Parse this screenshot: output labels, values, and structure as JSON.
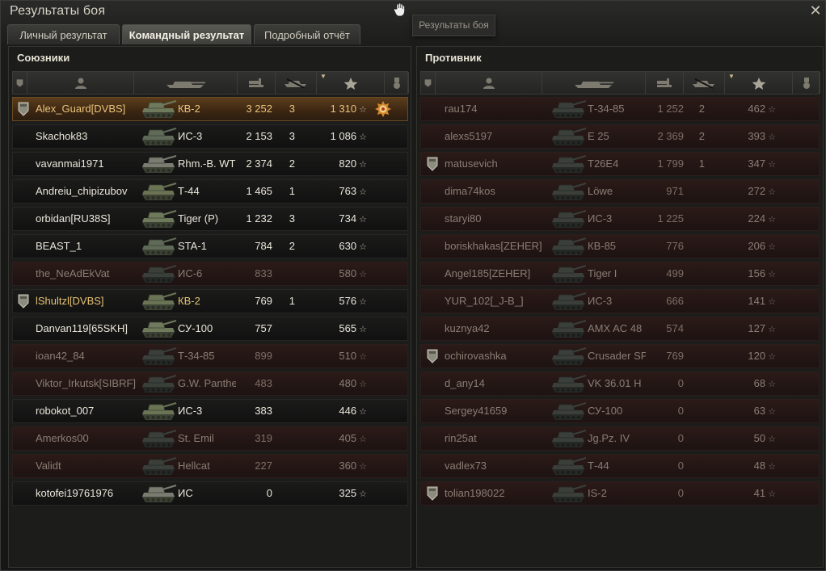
{
  "window": {
    "title": "Результаты боя",
    "tooltip": "Результаты боя"
  },
  "tabs": [
    {
      "label": "Личный результат",
      "active": false
    },
    {
      "label": "Командный результат",
      "active": true
    },
    {
      "label": "Подробный отчёт",
      "active": false
    }
  ],
  "columns": {
    "icons": [
      "clan-icon",
      "player-icon",
      "tank-icon",
      "damage-icon",
      "kills-icon",
      "xp-star-icon",
      "medal-icon"
    ],
    "sorted_by": "xp"
  },
  "allies": {
    "label": "Союзники",
    "rows": [
      {
        "name": "Alex_Guard[DVBS]",
        "vehicle": "КВ-2",
        "damage": "3 252",
        "kills": "3",
        "xp": "1 310",
        "state": "self",
        "clan": true,
        "medal": true
      },
      {
        "name": "Skachok83",
        "vehicle": "ИС-3",
        "damage": "2 153",
        "kills": "3",
        "xp": "1 086",
        "state": "alive"
      },
      {
        "name": "vavanmai1971",
        "vehicle": "Rhm.-B. WT",
        "damage": "2 374",
        "kills": "2",
        "xp": "820",
        "state": "alive"
      },
      {
        "name": "Andreiu_chipizubov",
        "vehicle": "Т-44",
        "damage": "1 465",
        "kills": "1",
        "xp": "763",
        "state": "alive"
      },
      {
        "name": "orbidan[RU38S]",
        "vehicle": "Tiger (P)",
        "damage": "1 232",
        "kills": "3",
        "xp": "734",
        "state": "alive"
      },
      {
        "name": "BEAST_1",
        "vehicle": "STA-1",
        "damage": "784",
        "kills": "2",
        "xp": "630",
        "state": "alive"
      },
      {
        "name": "the_NeAdEkVat",
        "vehicle": "ИС-6",
        "damage": "833",
        "kills": "",
        "xp": "580",
        "state": "dead"
      },
      {
        "name": "lShultzl[DVBS]",
        "vehicle": "КВ-2",
        "damage": "769",
        "kills": "1",
        "xp": "576",
        "state": "alive",
        "gold": true,
        "clan": true
      },
      {
        "name": "Danvan119[65SKH]",
        "vehicle": "СУ-100",
        "damage": "757",
        "kills": "",
        "xp": "565",
        "state": "alive"
      },
      {
        "name": "ioan42_84",
        "vehicle": "Т-34-85",
        "damage": "899",
        "kills": "",
        "xp": "510",
        "state": "dead"
      },
      {
        "name": "Viktor_Irkutsk[SIBRF]",
        "vehicle": "G.W. Panther",
        "damage": "483",
        "kills": "",
        "xp": "480",
        "state": "dead"
      },
      {
        "name": "robokot_007",
        "vehicle": "ИС-3",
        "damage": "383",
        "kills": "",
        "xp": "446",
        "state": "alive"
      },
      {
        "name": "Amerkos00",
        "vehicle": "St. Emil",
        "damage": "319",
        "kills": "",
        "xp": "405",
        "state": "dead"
      },
      {
        "name": "Validt",
        "vehicle": "Hellcat",
        "damage": "227",
        "kills": "",
        "xp": "360",
        "state": "dead"
      },
      {
        "name": "kotofei19761976",
        "vehicle": "ИС",
        "damage": "0",
        "kills": "",
        "xp": "325",
        "state": "alive"
      }
    ]
  },
  "enemies": {
    "label": "Противник",
    "rows": [
      {
        "name": "rau174",
        "vehicle": "Т-34-85",
        "damage": "1 252",
        "kills": "2",
        "xp": "462",
        "state": "dead"
      },
      {
        "name": "alexs5197",
        "vehicle": "E 25",
        "damage": "2 369",
        "kills": "2",
        "xp": "393",
        "state": "dead"
      },
      {
        "name": "matusevich",
        "vehicle": "T26E4",
        "damage": "1 799",
        "kills": "1",
        "xp": "347",
        "state": "dead",
        "clan": true
      },
      {
        "name": "dima74kos",
        "vehicle": "Löwe",
        "damage": "971",
        "kills": "",
        "xp": "272",
        "state": "dead"
      },
      {
        "name": "staryi80",
        "vehicle": "ИС-3",
        "damage": "1 225",
        "kills": "",
        "xp": "224",
        "state": "dead"
      },
      {
        "name": "boriskhakas[ZEHER]",
        "vehicle": "КВ-85",
        "damage": "776",
        "kills": "",
        "xp": "206",
        "state": "dead"
      },
      {
        "name": "Angel185[ZEHER]",
        "vehicle": "Tiger I",
        "damage": "499",
        "kills": "",
        "xp": "156",
        "state": "dead"
      },
      {
        "name": "YUR_102[_J-B_]",
        "vehicle": "ИС-3",
        "damage": "666",
        "kills": "",
        "xp": "141",
        "state": "dead"
      },
      {
        "name": "kuznya42",
        "vehicle": "AMX AC 48",
        "damage": "574",
        "kills": "",
        "xp": "127",
        "state": "dead"
      },
      {
        "name": "ochirovashka",
        "vehicle": "Crusader SP",
        "damage": "769",
        "kills": "",
        "xp": "120",
        "state": "dead",
        "clan": true
      },
      {
        "name": "d_any14",
        "vehicle": "VK 36.01 H",
        "damage": "0",
        "kills": "",
        "xp": "68",
        "state": "dead"
      },
      {
        "name": "Sergey41659",
        "vehicle": "СУ-100",
        "damage": "0",
        "kills": "",
        "xp": "63",
        "state": "dead"
      },
      {
        "name": "rin25at",
        "vehicle": "Jg.Pz. IV",
        "damage": "0",
        "kills": "",
        "xp": "50",
        "state": "dead"
      },
      {
        "name": "vadlex73",
        "vehicle": "Т-44",
        "damage": "0",
        "kills": "",
        "xp": "48",
        "state": "dead"
      },
      {
        "name": "tolian198022",
        "vehicle": "IS-2",
        "damage": "0",
        "kills": "",
        "xp": "41",
        "state": "dead",
        "clan": true
      }
    ]
  },
  "xp_suffix": "☆",
  "close_glyph": "✕"
}
